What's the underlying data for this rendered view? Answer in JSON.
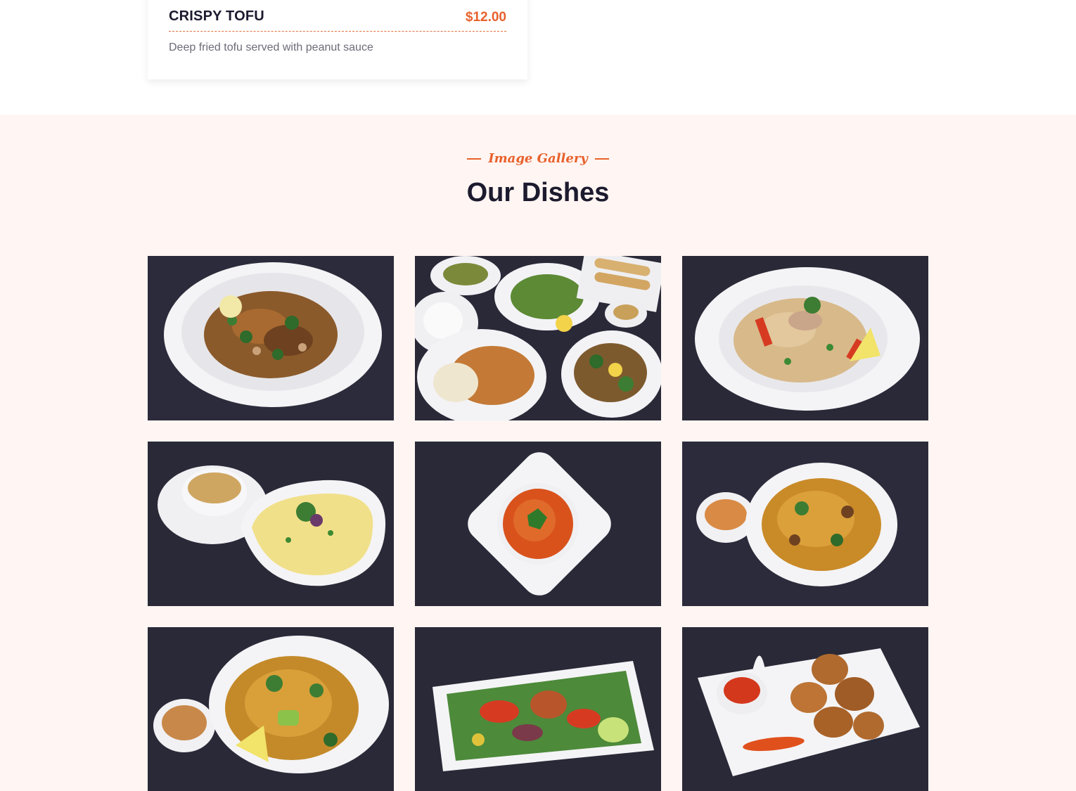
{
  "menu_item": {
    "name": "CRISPY TOFU",
    "price": "$12.00",
    "description": "Deep fried tofu served with peanut sauce"
  },
  "gallery": {
    "eyebrow": "Image Gallery",
    "title": "Our Dishes",
    "images": [
      {
        "name": "drunken-noodles-dish"
      },
      {
        "name": "assorted-dishes-spread"
      },
      {
        "name": "fried-rice-dish"
      },
      {
        "name": "yellow-curry-dish"
      },
      {
        "name": "tom-yum-soup-dish"
      },
      {
        "name": "lo-mein-noodles-dish"
      },
      {
        "name": "stir-fry-noodles-dish"
      },
      {
        "name": "salad-platter-dish"
      },
      {
        "name": "fried-chicken-wings-dish"
      }
    ]
  },
  "colors": {
    "accent": "#e8612c",
    "heading": "#1c1a2e",
    "gallery_bg": "#fff5f2",
    "photo_bg": "#2b2a3a"
  }
}
